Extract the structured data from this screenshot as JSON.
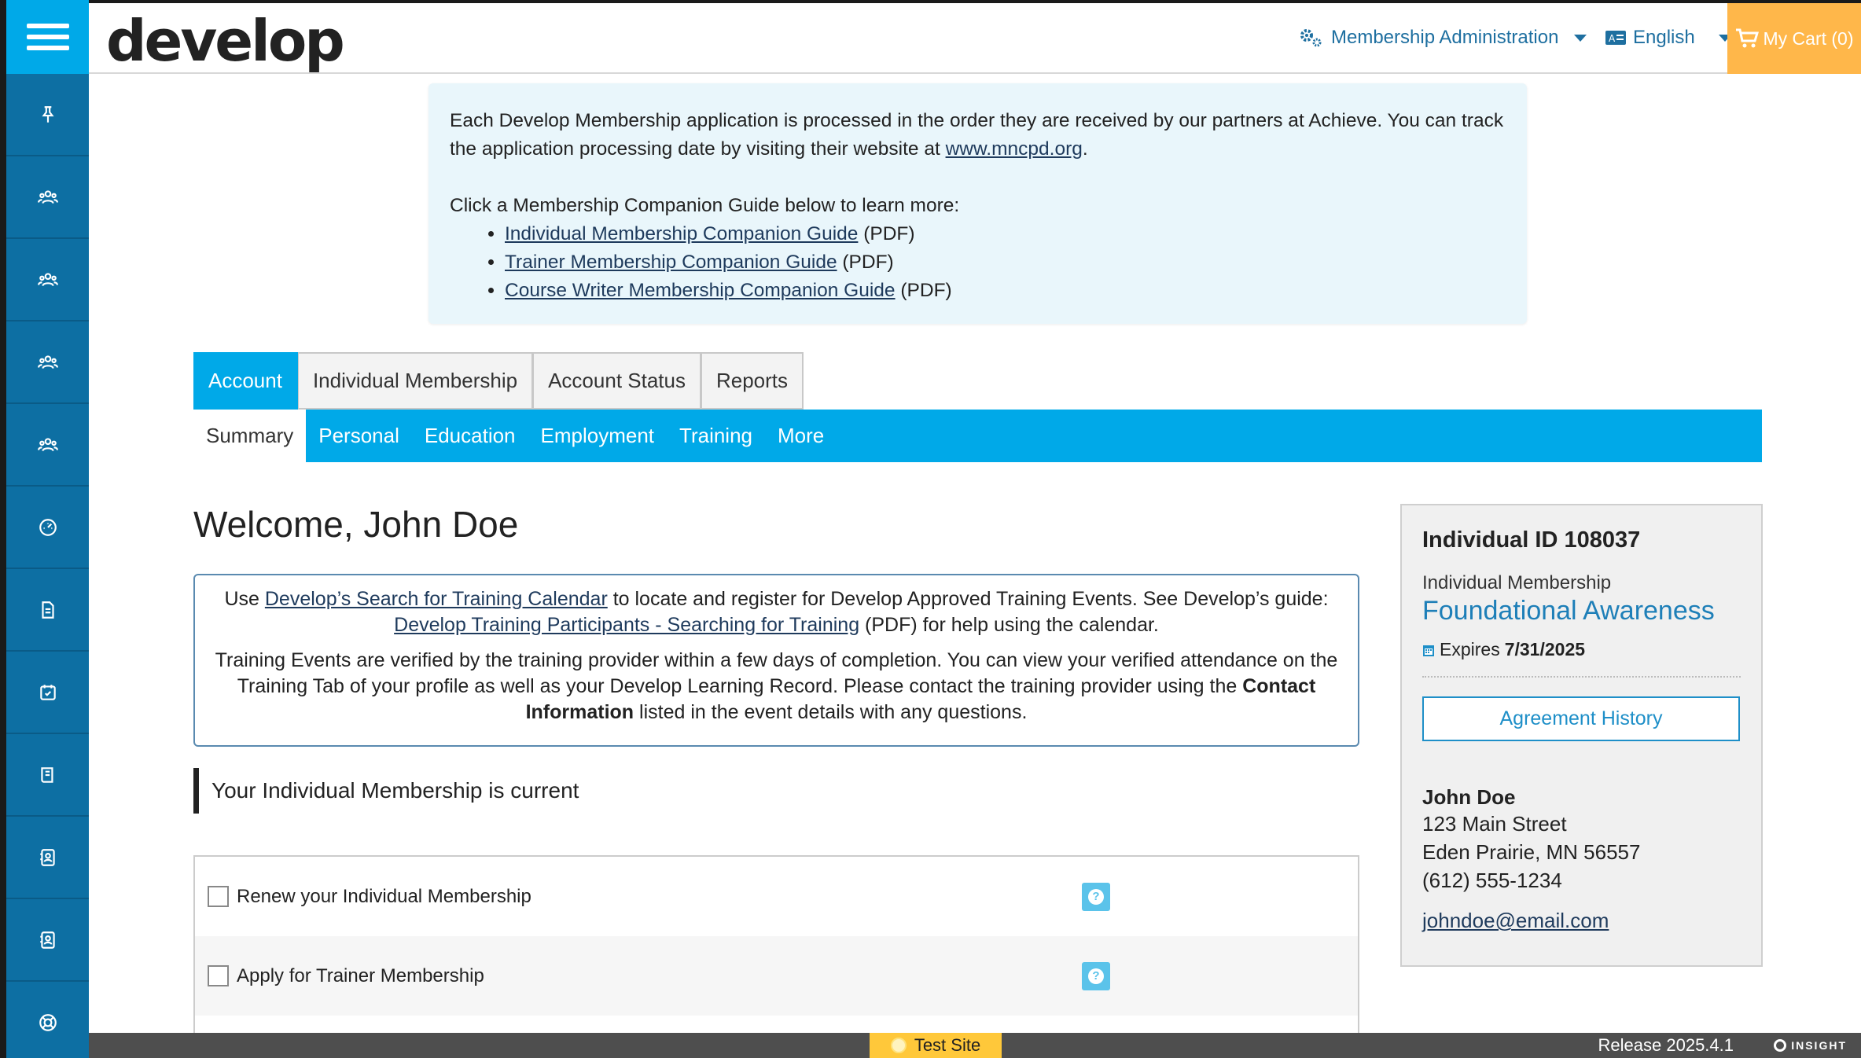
{
  "header": {
    "logo_text": "develop",
    "admin_menu": "Membership Administration",
    "language": "English",
    "cart": "My Cart (0)",
    "colors": {
      "rail": "#0d6fa3",
      "accent": "#00a9e8",
      "cart": "#ffb74a"
    }
  },
  "rail": {
    "icons": [
      "pin-icon",
      "users-icon",
      "users-icon",
      "users-icon",
      "users-icon",
      "dashboard-icon",
      "document-icon",
      "calendar-icon",
      "book-icon",
      "contact-card-icon",
      "contact-card-icon",
      "support-icon"
    ]
  },
  "notice": {
    "line1_pre": "Each Develop Membership application is processed in the order they are received by our partners at Achieve. You can track the application processing date by visiting their website at ",
    "link": "www.mncpd.org",
    "line1_post": ".",
    "guide_intro": "Click a Membership Companion Guide below to learn more:",
    "guides": [
      {
        "label": "Individual Membership Companion Guide",
        "suffix": " (PDF)"
      },
      {
        "label": "Trainer Membership Companion Guide",
        "suffix": " (PDF)"
      },
      {
        "label": "Course Writer Membership Companion Guide",
        "suffix": " (PDF)"
      }
    ]
  },
  "tabs": [
    "Account",
    "Individual Membership",
    "Account Status",
    "Reports"
  ],
  "subtabs": [
    "Summary",
    "Personal",
    "Education",
    "Employment",
    "Training",
    "More"
  ],
  "main": {
    "welcome": "Welcome, John Doe",
    "training": {
      "use": "Use ",
      "calendar_link": "Develop’s Search for Training Calendar",
      "mid": " to locate and register for Develop Approved Training Events. See Develop’s guide: ",
      "guide_link": "Develop Training Participants - Searching for Training",
      "end": " (PDF) for help using the calendar.",
      "para2_pre": "Training Events are verified by the training provider within a few days of completion. You can view your verified attendance on the Training Tab of your profile as well as your Develop Learning Record. Please contact the training provider using the ",
      "para2_bold": "Contact Information",
      "para2_post": " listed in the event details with any questions."
    },
    "status": "Your Individual Membership is current",
    "actions": [
      "Renew your Individual Membership",
      "Apply for Trainer Membership"
    ]
  },
  "card": {
    "id": "Individual ID 108037",
    "membership_type": "Individual Membership",
    "level": "Foundational Awareness",
    "expires_label": "Expires ",
    "expires_date": "7/31/2025",
    "agreement_button": "Agreement History",
    "name": "John Doe",
    "street": "123 Main Street",
    "city": "Eden Prairie, MN 56557",
    "phone": "(612) 555-1234",
    "email": "johndoe@email.com"
  },
  "footer": {
    "test_site": "Test Site",
    "release": "Release 2025.4.1",
    "brand": "INSIGHT"
  }
}
